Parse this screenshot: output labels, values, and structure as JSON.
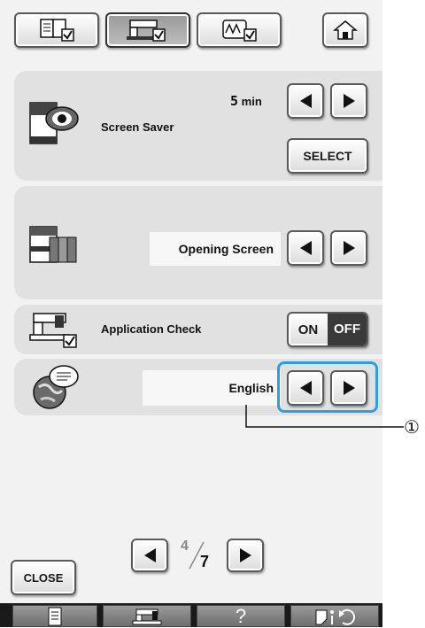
{
  "tabs": [
    {
      "icon": "manual-settings-icon",
      "selected": false
    },
    {
      "icon": "machine-settings-icon",
      "selected": true
    },
    {
      "icon": "embroidery-settings-icon",
      "selected": false
    }
  ],
  "home_icon": "home-icon",
  "screen_saver": {
    "label": "Screen Saver",
    "time_value": "5",
    "time_unit": "min",
    "select_label": "SELECT"
  },
  "opening_screen": {
    "value": "Opening Screen"
  },
  "application_check": {
    "label": "Application Check",
    "on_label": "ON",
    "off_label": "OFF",
    "state": "OFF"
  },
  "language": {
    "value": "English"
  },
  "pager": {
    "current": "4",
    "total": "7"
  },
  "close_label": "CLOSE",
  "bottom_bar": {
    "help_label": "?",
    "icons": [
      "document-icon",
      "sewing-machine-icon",
      "help-icon",
      "presser-foot-icon"
    ]
  },
  "callout": {
    "number": "①"
  },
  "colors": {
    "highlight": "#2f9ee0",
    "panel": "#e1e1e1",
    "background": "#f2f2f2"
  }
}
